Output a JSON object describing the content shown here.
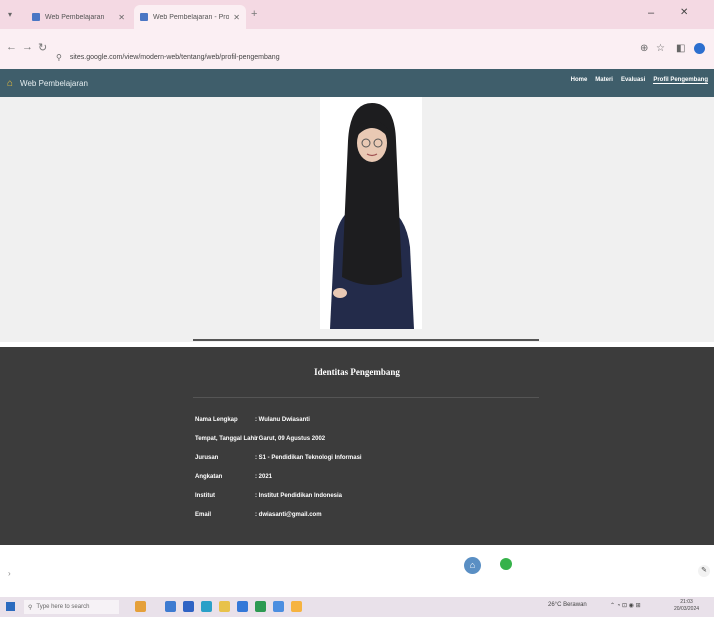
{
  "browser": {
    "tabs": [
      {
        "title": "Web Pembelajaran"
      },
      {
        "title": "Web Pembelajaran - Profil Pen..."
      }
    ],
    "url": "sites.google.com/view/modern-web/tentang/web/profil-pengembang"
  },
  "site": {
    "title": "Web Pembelajaran",
    "nav": [
      "Home",
      "Materi",
      "Evaluasi",
      "Profil Pengembang"
    ],
    "active_nav": "Profil Pengembang"
  },
  "identity": {
    "title": "Identitas Pengembang",
    "rows": [
      {
        "label": "Nama Lengkap",
        "value": ": Wulanu Dwiasanti"
      },
      {
        "label": "Tempat, Tanggal Lahir",
        "value": ": Garut, 09 Agustus 2002"
      },
      {
        "label": "Jurusan",
        "value": ": S1 - Pendidikan Teknologi Informasi"
      },
      {
        "label": "Angkatan",
        "value": ": 2021"
      },
      {
        "label": "Institut",
        "value": ": Institut Pendidikan Indonesia"
      },
      {
        "label": "Email",
        "value": ": dwiasanti@gmail.com"
      }
    ]
  },
  "taskbar": {
    "search_placeholder": "Type here to search",
    "weather": "26°C Berawan",
    "time": "21:03",
    "date": "20/03/2024"
  },
  "icons": [
    "menu-icon",
    "back-icon",
    "forward-icon",
    "reload-icon",
    "site-info-icon",
    "translate-icon",
    "star-icon",
    "extensions-icon",
    "home-icon",
    "whatsapp-icon",
    "edit-icon",
    "windows-start-icon"
  ]
}
